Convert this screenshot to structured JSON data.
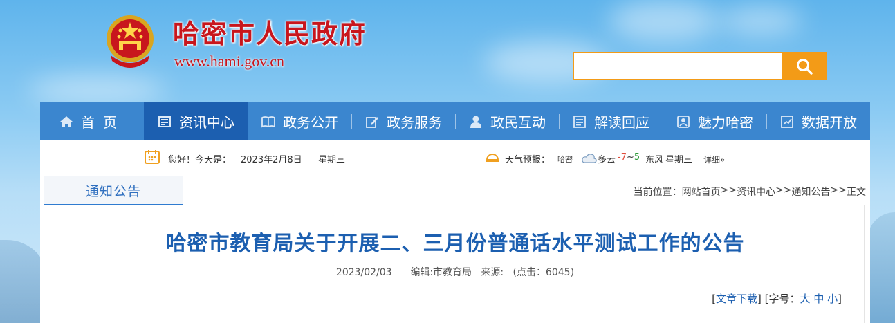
{
  "header": {
    "title": "哈密市人民政府",
    "url": "www.hami.gov.cn",
    "search_placeholder": ""
  },
  "nav": {
    "items": [
      {
        "label": "首页",
        "icon": "home-icon"
      },
      {
        "label": "资讯中心",
        "icon": "news-icon",
        "active": true
      },
      {
        "label": "政务公开",
        "icon": "book-icon"
      },
      {
        "label": "政务服务",
        "icon": "edit-icon"
      },
      {
        "label": "政民互动",
        "icon": "user-icon"
      },
      {
        "label": "解读回应",
        "icon": "document-icon"
      },
      {
        "label": "魅力哈密",
        "icon": "photo-icon"
      },
      {
        "label": "数据开放",
        "icon": "chart-icon"
      }
    ]
  },
  "infobar": {
    "greeting": "您好！今天是：",
    "date": "2023年2月8日",
    "weekday": "星期三",
    "weather_label": "天气预报：",
    "city": "哈密",
    "condition": "多云",
    "temp_low": "-7",
    "temp_sep": "~",
    "temp_high": "5",
    "wind": "东风",
    "weather_day": "星期三",
    "more": "详细»"
  },
  "section": {
    "tab_label": "通知公告",
    "breadcrumb_prefix": "当前位置：",
    "breadcrumb": [
      "网站首页",
      ">>",
      "资讯中心",
      ">>",
      "通知公告",
      ">>",
      "正文"
    ]
  },
  "article": {
    "title": "哈密市教育局关于开展二、三月份普通话水平测试工作的公告",
    "date": "2023/02/03",
    "editor": "编辑:市教育局",
    "source": "来源:",
    "hits_label": "(点击：",
    "hits": "6045",
    "hits_close": ")",
    "download": "文章下载",
    "font_label": "字号：",
    "font_large": "大",
    "font_medium": "中",
    "font_small": "小"
  },
  "colors": {
    "brand_red": "#c8161d",
    "nav_blue": "#3b86cf",
    "nav_active": "#1c5fb0",
    "search_orange": "#f39b17"
  }
}
